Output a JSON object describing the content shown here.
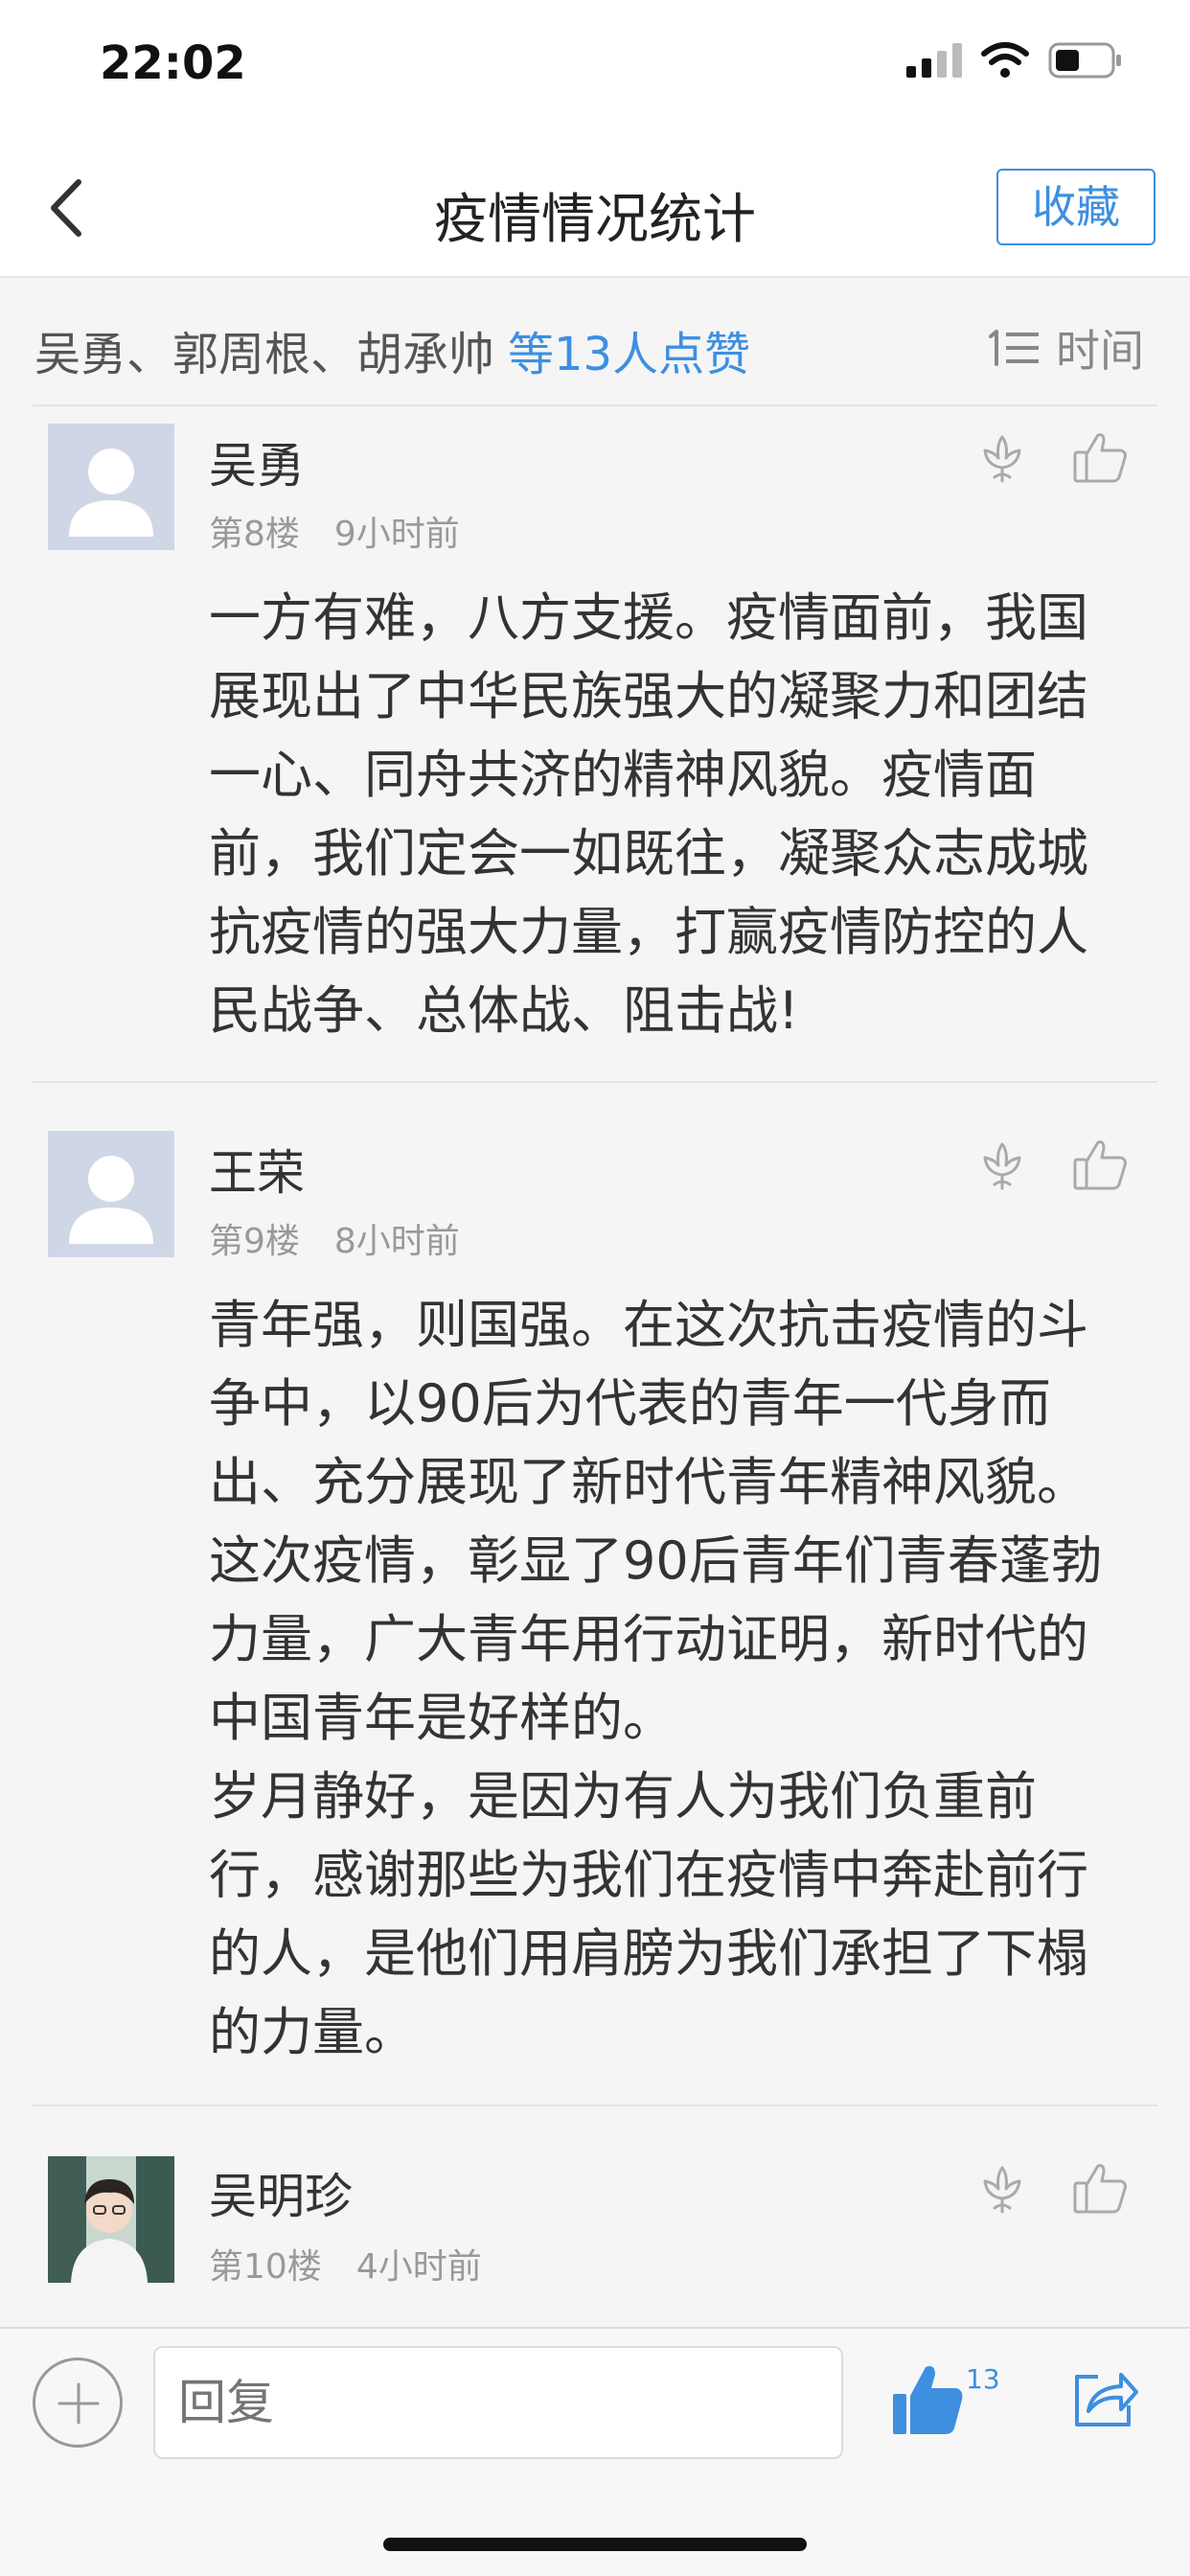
{
  "status_bar": {
    "time": "22:02"
  },
  "nav": {
    "title": "疫情情况统计",
    "favorite_label": "收藏"
  },
  "likes": {
    "names": "吴勇、郭周根、胡承帅",
    "count_link": "等13人点赞",
    "sort_label": "时间"
  },
  "comments": [
    {
      "author": "吴勇",
      "floor": "第8楼",
      "time": "9小时前",
      "text": "一方有难，八方支援。疫情面前，我国展现出了中华民族强大的凝聚力和团结一心、同舟共济的精神风貌。疫情面前，我们定会一如既往，凝聚众志成城抗疫情的强大力量，打赢疫情防控的人民战争、总体战、阻击战!"
    },
    {
      "author": "王荣",
      "floor": "第9楼",
      "time": "8小时前",
      "text": "青年强，则国强。在这次抗击疫情的斗争中，以90后为代表的青年一代身而出、充分展现了新时代青年精神风貌。这次疫情，彰显了90后青年们青春蓬勃力量，广大青年用行动证明，新时代的中国青年是好样的。\n岁月静好，是因为有人为我们负重前行，感谢那些为我们在疫情中奔赴前行的人，是他们用肩膀为我们承担了下榻的力量。"
    },
    {
      "author": "吴明珍",
      "floor": "第10楼",
      "time": "4小时前",
      "text": ""
    }
  ],
  "bottom_bar": {
    "reply_placeholder": "回复",
    "like_count": "13"
  },
  "colors": {
    "accent": "#3e8fe0",
    "avatar_placeholder": "#cfd6e6"
  }
}
